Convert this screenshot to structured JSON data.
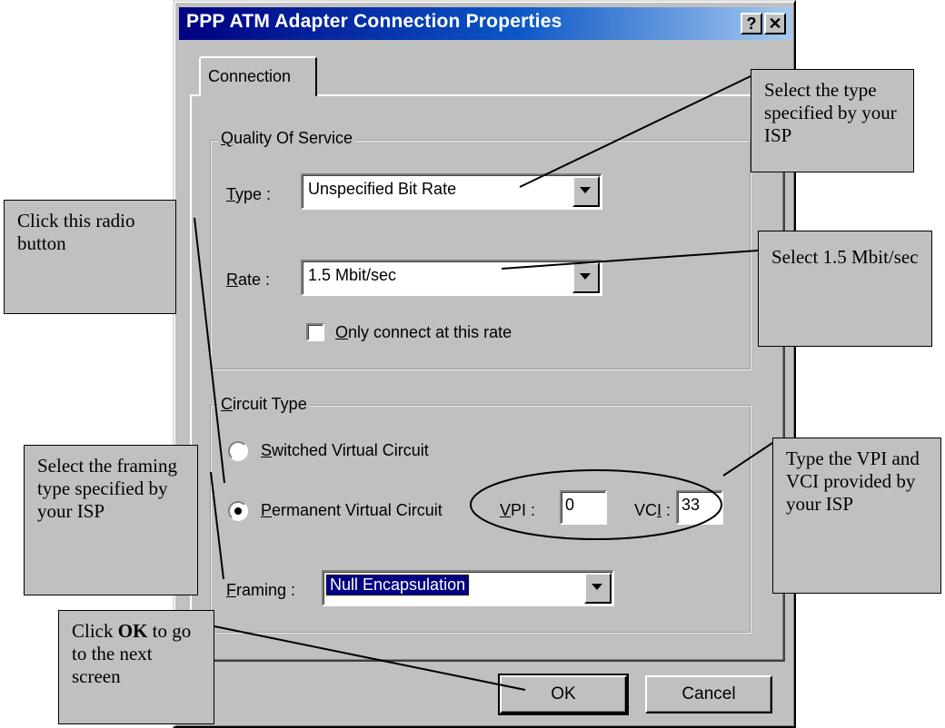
{
  "window": {
    "title": "PPP ATM Adapter Connection Properties",
    "help_label": "?",
    "close_label": "✕"
  },
  "tabs": [
    {
      "label": "Connection"
    }
  ],
  "qos": {
    "legend_prefix": "Q",
    "legend_rest": "uality Of Service",
    "type_label_u": "T",
    "type_label_rest": "ype :",
    "type_value": "Unspecified Bit Rate",
    "rate_label_u": "R",
    "rate_label_rest": "ate :",
    "rate_value": "1.5 Mbit/sec",
    "only_connect_u": "O",
    "only_connect_rest": "nly connect at this rate"
  },
  "circuit": {
    "legend_u": "C",
    "legend_rest": "ircuit Type",
    "svc_u": "S",
    "svc_rest": "witched Virtual Circuit",
    "pvc_u": "P",
    "pvc_rest": "ermanent Virtual Circuit",
    "vpi_u": "V",
    "vpi_rest": "PI :",
    "vpi_value": "0",
    "vci_pre": "VC",
    "vci_u": "I",
    "vci_rest": " :",
    "vci_value": "33",
    "framing_u": "F",
    "framing_rest": "raming :",
    "framing_value": "Null Encapsulation"
  },
  "buttons": {
    "ok": "OK",
    "cancel": "Cancel"
  },
  "callouts": {
    "select_type": "Select the type specified by your ISP",
    "select_rate": "Select 1.5 Mbit/sec",
    "click_radio": "Click this radio button",
    "select_framing": "Select the framing type specified by your ISP",
    "vpi_vci": "Type the VPI and VCI provided by your ISP",
    "click_ok_pre": "Click ",
    "click_ok_bold": "OK",
    "click_ok_post": " to go to the next screen"
  }
}
